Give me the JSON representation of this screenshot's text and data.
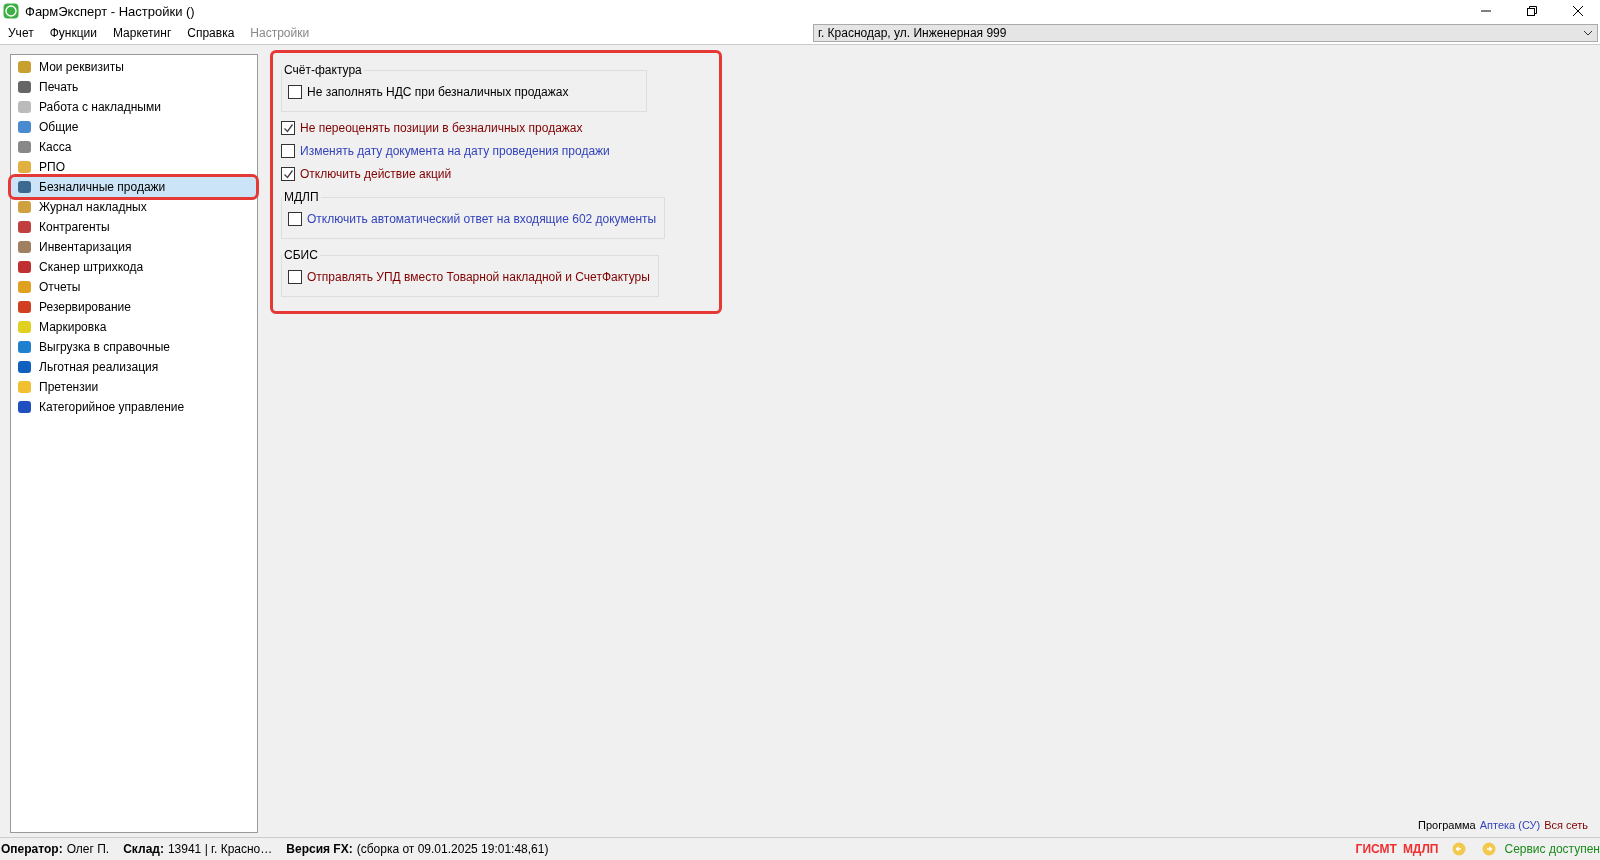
{
  "window": {
    "title": "ФармЭксперт - Настройки ()"
  },
  "menu": [
    {
      "label": "Учет",
      "disabled": false
    },
    {
      "label": "Функции",
      "disabled": false
    },
    {
      "label": "Маркетинг",
      "disabled": false
    },
    {
      "label": "Справка",
      "disabled": false
    },
    {
      "label": "Настройки",
      "disabled": true
    }
  ],
  "store_select": {
    "value": "г. Краснодар, ул. Инженерная 999"
  },
  "sidebar": {
    "items": [
      {
        "label": "Мои реквизиты",
        "selected": false,
        "highlighted": false
      },
      {
        "label": "Печать",
        "selected": false,
        "highlighted": false
      },
      {
        "label": "Работа с накладными",
        "selected": false,
        "highlighted": false
      },
      {
        "label": "Общие",
        "selected": false,
        "highlighted": false
      },
      {
        "label": "Касса",
        "selected": false,
        "highlighted": false
      },
      {
        "label": "РПО",
        "selected": false,
        "highlighted": false
      },
      {
        "label": "Безналичные продажи",
        "selected": true,
        "highlighted": true
      },
      {
        "label": "Журнал накладных",
        "selected": false,
        "highlighted": false
      },
      {
        "label": "Контрагенты",
        "selected": false,
        "highlighted": false
      },
      {
        "label": "Инвентаризация",
        "selected": false,
        "highlighted": false
      },
      {
        "label": "Сканер штрихкода",
        "selected": false,
        "highlighted": false
      },
      {
        "label": "Отчеты",
        "selected": false,
        "highlighted": false
      },
      {
        "label": "Резервирование",
        "selected": false,
        "highlighted": false
      },
      {
        "label": "Маркировка",
        "selected": false,
        "highlighted": false
      },
      {
        "label": "Выгрузка в справочные",
        "selected": false,
        "highlighted": false
      },
      {
        "label": "Льготная реализация",
        "selected": false,
        "highlighted": false
      },
      {
        "label": "Претензии",
        "selected": false,
        "highlighted": false
      },
      {
        "label": "Категорийное управление",
        "selected": false,
        "highlighted": false
      }
    ]
  },
  "options": {
    "highlighted": true,
    "items": [
      {
        "kind": "group",
        "title": "Счёт-фактура",
        "items": [
          {
            "label": "Не заполнять НДС при безналичных продажах",
            "checked": false,
            "color": "#000000"
          }
        ]
      },
      {
        "kind": "check",
        "label": "Не переоценять позиции в безналичных продажах",
        "checked": true,
        "color": "#800000"
      },
      {
        "kind": "check",
        "label": "Изменять дату документа на дату проведения продажи",
        "checked": false,
        "color": "#3344bb"
      },
      {
        "kind": "check",
        "label": "Отключить действие акций",
        "checked": true,
        "color": "#800000"
      },
      {
        "kind": "group",
        "title": "МДЛП",
        "items": [
          {
            "label": "Отключить автоматический ответ на входящие 602 документы",
            "checked": false,
            "color": "#3344bb"
          }
        ]
      },
      {
        "kind": "group",
        "title": "СБИС",
        "items": [
          {
            "label": "Отправлять УПД вместо Товарной накладной и СчетФактуры",
            "checked": false,
            "color": "#800000"
          }
        ]
      }
    ]
  },
  "program_info": {
    "label": "Программа",
    "product": "Аптека (СУ)",
    "scope": "Вся сеть"
  },
  "status_bar": {
    "left": [
      {
        "label": "Оператор:",
        "value": "Олег П."
      },
      {
        "label": "Склад:",
        "value": "13941 | г. Красно…"
      },
      {
        "label": "Версия FX:",
        "value": "(сборка от 09.01.2025 19:01:48,61)"
      }
    ],
    "badges": [
      "ГИСМТ",
      "МДЛП"
    ],
    "service": "Сервис доступен"
  }
}
